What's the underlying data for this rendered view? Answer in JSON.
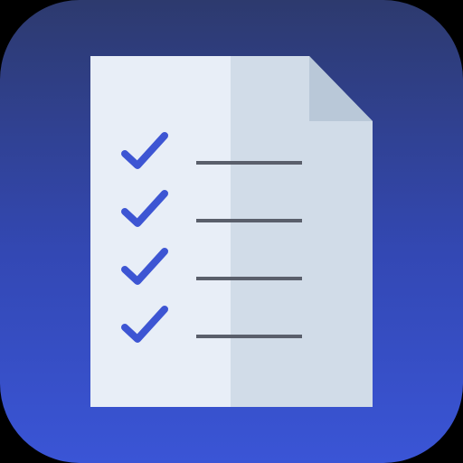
{
  "app_icon": {
    "icon": "checklist-document-icon",
    "colors": {
      "background_top": "#2d3a6e",
      "background_bottom": "#3a55d6",
      "page_light": "#e8eef7",
      "page_shade": "#d1dce8",
      "page_fold": "#b9c8d8",
      "checkmark": "#3d55d3",
      "line": "#5a5f6b"
    },
    "checklist": {
      "rows": [
        {
          "checked": true
        },
        {
          "checked": true
        },
        {
          "checked": true
        },
        {
          "checked": true
        }
      ]
    }
  }
}
